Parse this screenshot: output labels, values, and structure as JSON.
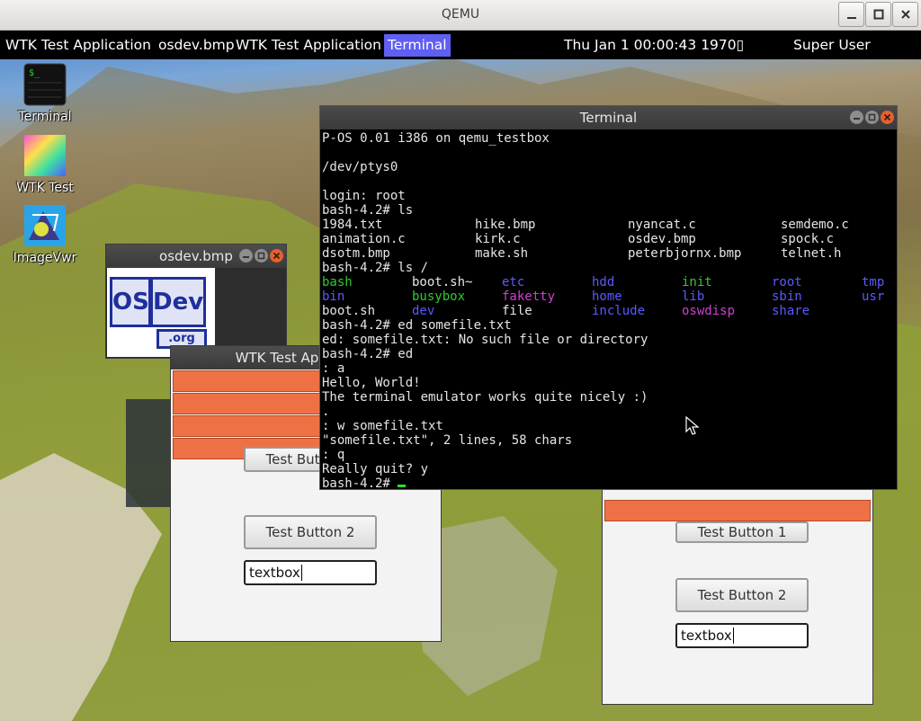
{
  "qemu": {
    "title": "QEMU"
  },
  "panel": {
    "items": [
      "WTK Test Application",
      "osdev.bmp",
      "WTK Test Application",
      "Terminal"
    ],
    "clock": "Thu Jan  1 00:00:43 1970▯",
    "user": "Super User"
  },
  "desktop_icons": [
    {
      "label": "Terminal"
    },
    {
      "label": "WTK Test"
    },
    {
      "label": "ImageVwr"
    }
  ],
  "osdev_window": {
    "title": "osdev.bmp",
    "logo_os": "OS",
    "logo_dev": "Dev",
    "logo_org": ".org"
  },
  "wtk_left": {
    "title": "WTK Test Application",
    "button1": "Test Button 1",
    "button2": "Test Button 2",
    "textbox": "textbox"
  },
  "wtk_right": {
    "button1": "Test Button 1",
    "button2": "Test Button 2",
    "textbox": "textbox"
  },
  "terminal": {
    "title": "Terminal",
    "lines_before_ls": [
      "P-OS 0.01 i386 on qemu_testbox",
      "",
      "/dev/ptys0",
      "",
      "login: root",
      "bash-4.2# ls"
    ],
    "ls1": [
      [
        "1984.txt",
        "hike.bmp",
        "nyancat.c",
        "semdemo.c"
      ],
      [
        "animation.c",
        "kirk.c",
        "osdev.bmp",
        "spock.c"
      ],
      [
        "dsotm.bmp",
        "make.sh",
        "peterbjornx.bmp",
        "telnet.h"
      ]
    ],
    "ls_root_cmd": "bash-4.2# ls /",
    "ls2": [
      [
        {
          "t": "bash",
          "c": "#2ecc2e"
        },
        {
          "t": "boot.sh~",
          "c": "#e6e6e6"
        },
        {
          "t": "etc",
          "c": "#5a5aff"
        },
        {
          "t": "hdd",
          "c": "#5a5aff"
        },
        {
          "t": "init",
          "c": "#2ecc2e"
        },
        {
          "t": "root",
          "c": "#5a5aff"
        },
        {
          "t": "tmp",
          "c": "#5a5aff"
        }
      ],
      [
        {
          "t": "bin",
          "c": "#5a5aff"
        },
        {
          "t": "busybox",
          "c": "#2ecc2e"
        },
        {
          "t": "faketty",
          "c": "#d040d0"
        },
        {
          "t": "home",
          "c": "#5a5aff"
        },
        {
          "t": "lib",
          "c": "#5a5aff"
        },
        {
          "t": "sbin",
          "c": "#5a5aff"
        },
        {
          "t": "usr",
          "c": "#5a5aff"
        }
      ],
      [
        {
          "t": "boot.sh",
          "c": "#e6e6e6"
        },
        {
          "t": "dev",
          "c": "#5a5aff"
        },
        {
          "t": "file",
          "c": "#e6e6e6"
        },
        {
          "t": "include",
          "c": "#5a5aff"
        },
        {
          "t": "oswdisp",
          "c": "#d040d0"
        },
        {
          "t": "share",
          "c": "#5a5aff"
        },
        {
          "t": "",
          "c": "#e6e6e6"
        }
      ]
    ],
    "lines_after_ls": [
      "bash-4.2# ed somefile.txt",
      "ed: somefile.txt: No such file or directory",
      "bash-4.2# ed",
      ": a",
      "Hello, World!",
      "The terminal emulator works quite nicely :)",
      ".",
      ": w somefile.txt",
      "\"somefile.txt\", 2 lines, 58 chars",
      ": q",
      "Really quit? y"
    ],
    "prompt": "bash-4.2# "
  },
  "colors": {
    "panel_active": "#5f5ff2",
    "orange_bar": "#ee7145",
    "dir_blue": "#5a5aff",
    "exec_green": "#2ecc2e",
    "special_magenta": "#d040d0",
    "cursor_green": "#28e028"
  }
}
